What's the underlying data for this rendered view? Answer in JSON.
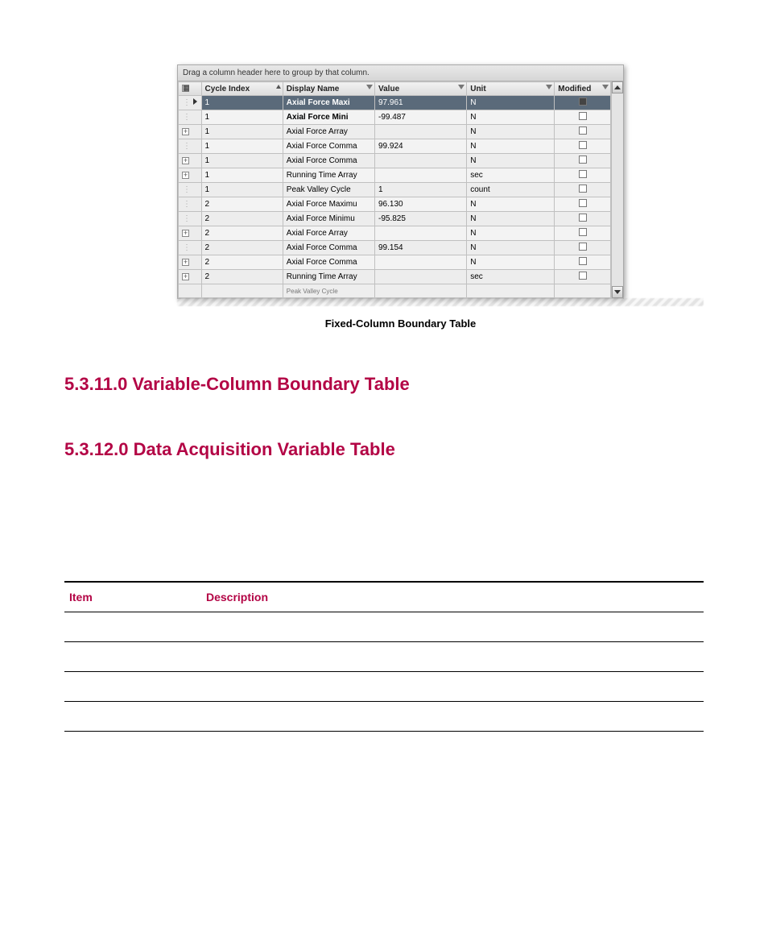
{
  "screenshot": {
    "drag_hint": "Drag a column header here to group by that column.",
    "columns": {
      "cycle": "Cycle Index",
      "name": "Display Name",
      "value": "Value",
      "unit": "Unit",
      "modified": "Modified"
    },
    "partial_row": "Peak Valley Cycle",
    "rows": [
      {
        "tree": "arrow",
        "cycle": "1",
        "name": "Axial Force Maxi",
        "value": "97.961",
        "unit": "N",
        "mod": true,
        "selected": true,
        "bold": true
      },
      {
        "tree": "dot",
        "cycle": "1",
        "name": "Axial Force Mini",
        "value": "-99.487",
        "unit": "N",
        "mod": false,
        "bold": true
      },
      {
        "tree": "expand",
        "cycle": "1",
        "name": "Axial Force Array",
        "value": "",
        "unit": "N",
        "mod": false
      },
      {
        "tree": "dot",
        "cycle": "1",
        "name": "Axial Force Comma",
        "value": "99.924",
        "unit": "N",
        "mod": false
      },
      {
        "tree": "expand",
        "cycle": "1",
        "name": "Axial Force Comma",
        "value": "",
        "unit": "N",
        "mod": false
      },
      {
        "tree": "expand",
        "cycle": "1",
        "name": "Running Time Array",
        "value": "",
        "unit": "sec",
        "mod": false
      },
      {
        "tree": "dot",
        "cycle": "1",
        "name": "Peak Valley Cycle",
        "value": "1",
        "unit": "count",
        "mod": false
      },
      {
        "tree": "dot",
        "cycle": "2",
        "name": "Axial Force Maximu",
        "value": "96.130",
        "unit": "N",
        "mod": false
      },
      {
        "tree": "dot",
        "cycle": "2",
        "name": "Axial Force Minimu",
        "value": "-95.825",
        "unit": "N",
        "mod": false
      },
      {
        "tree": "expand",
        "cycle": "2",
        "name": "Axial Force Array",
        "value": "",
        "unit": "N",
        "mod": false
      },
      {
        "tree": "dot",
        "cycle": "2",
        "name": "Axial Force Comma",
        "value": "99.154",
        "unit": "N",
        "mod": false
      },
      {
        "tree": "expand",
        "cycle": "2",
        "name": "Axial Force Comma",
        "value": "",
        "unit": "N",
        "mod": false
      },
      {
        "tree": "expand",
        "cycle": "2",
        "name": "Running Time Array",
        "value": "",
        "unit": "sec",
        "mod": false
      }
    ]
  },
  "figure_caption": "Fixed-Column Boundary Table",
  "heading_1": "5.3.11.0 Variable-Column Boundary Table",
  "heading_2": "5.3.12.0 Data Acquisition Variable Table",
  "desc_table": {
    "header_item": "Item",
    "header_desc": "Description",
    "rows": [
      {
        "item": "",
        "desc": ""
      },
      {
        "item": "",
        "desc": ""
      },
      {
        "item": "",
        "desc": ""
      },
      {
        "item": "",
        "desc": ""
      }
    ]
  }
}
